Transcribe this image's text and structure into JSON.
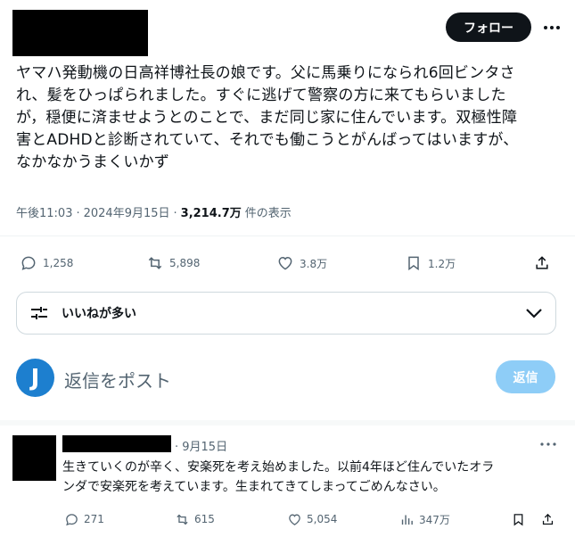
{
  "header": {
    "follow_label": "フォロー"
  },
  "tweet": {
    "lines": [
      "ヤマハ発動機の日高祥博社長の娘です。父に馬乗りになられ6回ビンタさ",
      "れ、髪をひっぱられました。すぐに逃げて警察の方に来てもらいました",
      "が，穏便に済ませようとのことで、まだ同じ家に住んでいます。双極性障",
      "害とADHDと診断されていて、それでも働こうとがんばってはいますが、",
      "なかなかうまくいかず"
    ],
    "time": "午後11:03",
    "sep1": "·",
    "date": "2024年9月15日",
    "sep2": "·",
    "views": "3,214.7万",
    "views_suffix": "件の表示",
    "replies": "1,258",
    "reposts": "5,898",
    "likes": "3.8万",
    "bookmarks": "1.2万"
  },
  "sort": {
    "label": "いいねが多い"
  },
  "composer": {
    "avatar_letter": "J",
    "placeholder": "返信をポスト",
    "reply_button": "返信"
  },
  "reply": {
    "date": "· 9月15日",
    "lines": [
      "生きていくのが辛く、安楽死を考え始めました。以前4年ほど住んでいたオラ",
      "ンダで安楽死を考えています。生まれてきてしまってごめんなさい。"
    ],
    "replies": "271",
    "reposts": "615",
    "likes": "5,054",
    "views": "347万"
  },
  "colors": {
    "accent": "#1d9bf0",
    "muted": "#536471",
    "text": "#0f1419",
    "reply_disabled": "#8ecdf7"
  }
}
